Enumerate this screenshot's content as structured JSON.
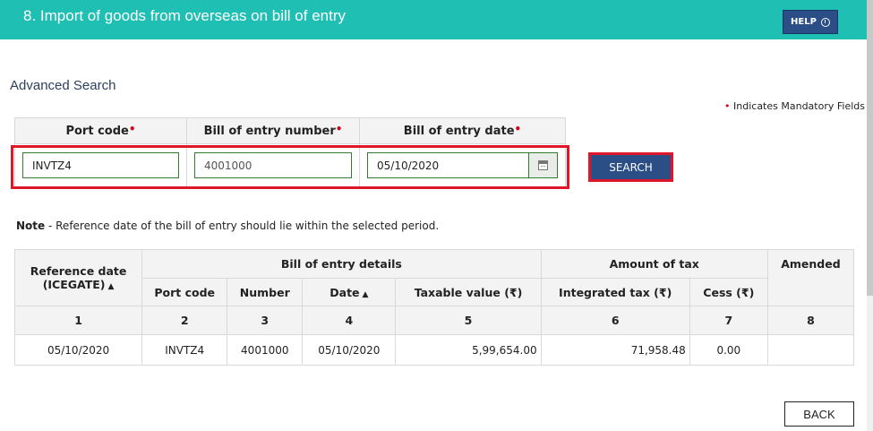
{
  "header": {
    "title": "8. Import of goods from overseas on bill of entry",
    "help_label": "HELP"
  },
  "search": {
    "heading": "Advanced Search",
    "mandatory_marker": "•",
    "mandatory_note": "Indicates Mandatory Fields",
    "columns": [
      "Port code",
      "Bill of entry number",
      "Bill of entry date"
    ],
    "port_code": "INVTZ4",
    "bill_number": "4001000",
    "bill_date": "05/10/2020",
    "button_label": "SEARCH"
  },
  "note": {
    "label": "Note",
    "text": " - Reference date of the bill of entry should lie within the selected period."
  },
  "table": {
    "header_row1": {
      "reference_date": "Reference date (ICEGATE)",
      "bill_details": "Bill of entry details",
      "amount_of_tax": "Amount of tax",
      "amended": "Amended"
    },
    "header_row2": [
      "Port code",
      "Number",
      "Date",
      "Taxable value (₹)",
      "Integrated tax (₹)",
      "Cess (₹)"
    ],
    "numbers": [
      "1",
      "2",
      "3",
      "4",
      "5",
      "6",
      "7",
      "8"
    ],
    "rows": [
      {
        "reference_date": "05/10/2020",
        "port_code": "INVTZ4",
        "number": "4001000",
        "date": "05/10/2020",
        "taxable_value": "5,99,654.00",
        "integrated_tax": "71,958.48",
        "cess": "0.00",
        "amended": ""
      }
    ]
  },
  "footer": {
    "back_label": "BACK"
  },
  "colors": {
    "header_bg": "#1fbfb3",
    "primary_button": "#2c4e86",
    "highlight": "#e0172a",
    "required": "#d0021b"
  }
}
